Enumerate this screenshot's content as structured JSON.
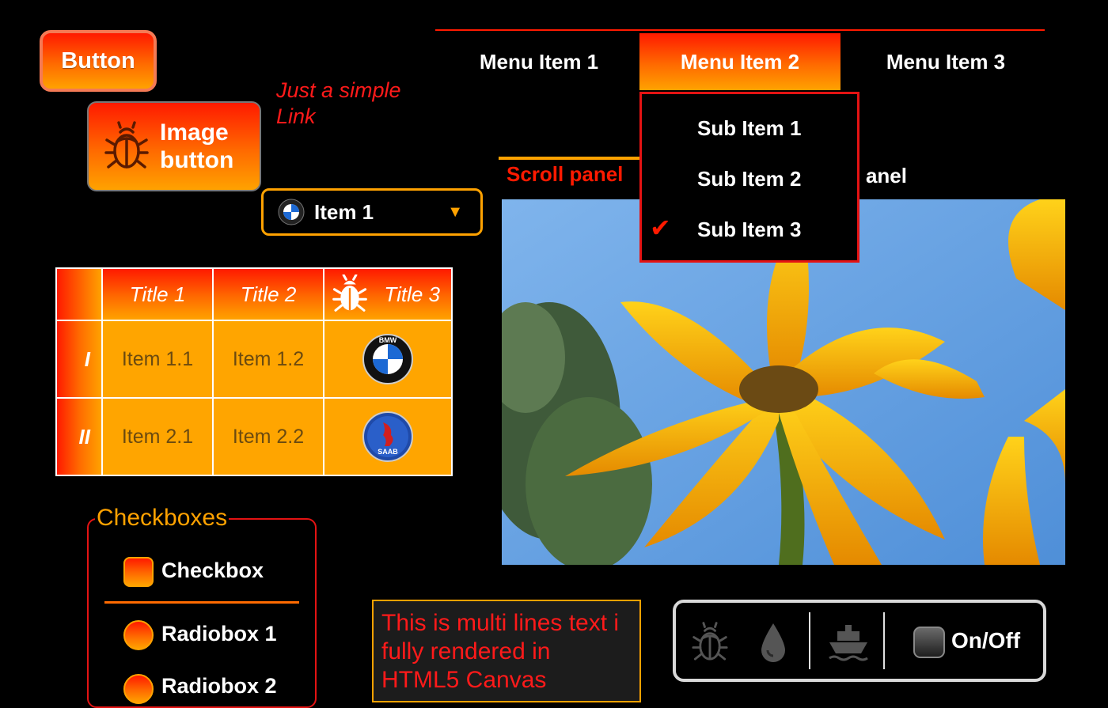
{
  "button": {
    "label": "Button"
  },
  "image_button": {
    "line1": "Image",
    "line2": "button",
    "icon": "bug-icon"
  },
  "link": {
    "line1": "Just a simple",
    "line2": "Link"
  },
  "combo": {
    "value": "Item 1",
    "icon": "bmw-logo-icon",
    "arrow": "▼"
  },
  "table": {
    "headers": [
      "Title 1",
      "Title 2",
      "Title 3"
    ],
    "header3_icon": "bug-icon",
    "rows": [
      {
        "label": "I",
        "cells": [
          "Item 1.1",
          "Item 1.2"
        ],
        "logo": "bmw-logo-icon",
        "logo_text": "BMW"
      },
      {
        "label": "II",
        "cells": [
          "Item 2.1",
          "Item 2.2"
        ],
        "logo": "saab-logo-icon",
        "logo_text": "SAAB"
      }
    ]
  },
  "menu": {
    "items": [
      "Menu Item 1",
      "Menu Item 2",
      "Menu Item 3"
    ],
    "active_index": 1,
    "submenu": [
      "Sub Item 1",
      "Sub Item 2",
      "Sub Item 3"
    ],
    "checked_index": 2,
    "check_glyph": "✔"
  },
  "tabs": {
    "tab1": "Scroll panel",
    "tab2_visible": "anel"
  },
  "checkboxes": {
    "title": "Checkboxes",
    "checkbox": "Checkbox",
    "radio1": "Radiobox 1",
    "radio2": "Radiobox 2"
  },
  "multiline_text": {
    "line1": "This is multi lines text i",
    "line2": "fully rendered in",
    "line3": "HTML5 Canvas"
  },
  "toolbar": {
    "icons": [
      "bug-icon",
      "drop-icon",
      "ship-icon"
    ],
    "toggle_label": "On/Off"
  },
  "colors": {
    "accent_red": "#ff1a00",
    "accent_orange": "#ffa200",
    "table_cell": "#ffa500"
  }
}
